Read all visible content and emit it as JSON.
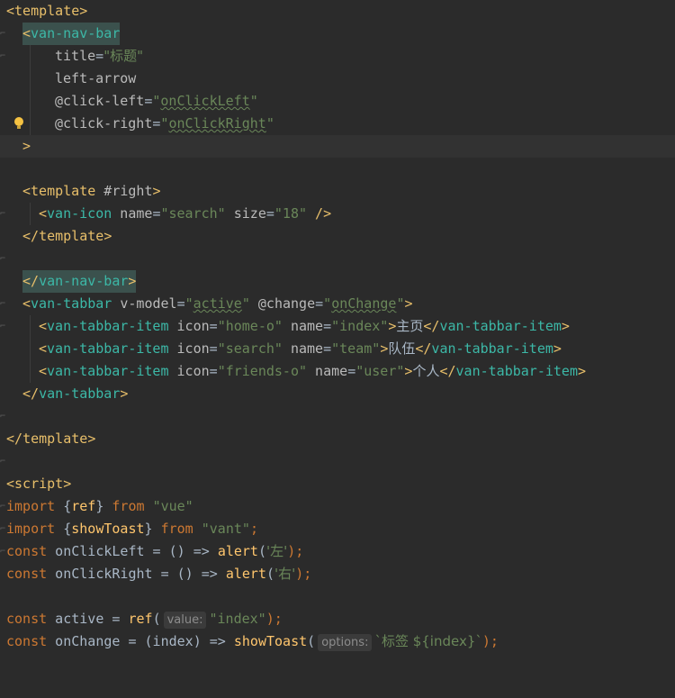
{
  "lines": {
    "l1": [
      "<",
      "template",
      ">"
    ],
    "l2": [
      "<",
      "van-nav-bar"
    ],
    "l3": [
      "title",
      "=",
      "\"标题\""
    ],
    "l4": [
      "left-arrow"
    ],
    "l5": [
      "@click-left",
      "=",
      "\"",
      "onClickLeft",
      "\""
    ],
    "l6": [
      "@click-right",
      "=",
      "\"",
      "onClickRight",
      "\""
    ],
    "l7": [
      ">"
    ],
    "l9": [
      "<",
      "template",
      " #right",
      ">"
    ],
    "l10": [
      "<",
      "van-icon",
      " name",
      "=",
      "\"search\"",
      " size",
      "=",
      "\"18\"",
      " />"
    ],
    "l11": [
      "</",
      "template",
      ">"
    ],
    "l13": [
      "</",
      "van-nav-bar",
      ">"
    ],
    "l14": [
      "<",
      "van-tabbar",
      " v-model",
      "=",
      "\"",
      "active",
      "\"",
      " @change",
      "=",
      "\"",
      "onChange",
      "\"",
      ">"
    ],
    "l15": [
      "<",
      "van-tabbar-item",
      " icon",
      "=",
      "\"home-o\"",
      " name",
      "=",
      "\"index\"",
      ">",
      "主页",
      "</",
      "van-tabbar-item",
      ">"
    ],
    "l16": [
      "<",
      "van-tabbar-item",
      " icon",
      "=",
      "\"search\"",
      " name",
      "=",
      "\"team\"",
      ">",
      "队伍",
      "</",
      "van-tabbar-item",
      ">"
    ],
    "l17": [
      "<",
      "van-tabbar-item",
      " icon",
      "=",
      "\"friends-o\"",
      " name",
      "=",
      "\"user\"",
      ">",
      "个人",
      "</",
      "van-tabbar-item",
      ">"
    ],
    "l18": [
      "</",
      "van-tabbar",
      ">"
    ],
    "l20": [
      "</",
      "template",
      ">"
    ],
    "l22": [
      "<",
      "script",
      ">"
    ],
    "l23": [
      "import",
      " {",
      "ref",
      "} ",
      "from",
      " ",
      "\"vue\""
    ],
    "l24": [
      "import",
      " {",
      "showToast",
      "} ",
      "from",
      " ",
      "\"vant\"",
      ";"
    ],
    "l25": [
      "const",
      " onClickLeft = () => ",
      "alert",
      "(",
      "'左'",
      ");"
    ],
    "l26": [
      "const",
      " onClickRight = () => ",
      "alert",
      "(",
      "'右'",
      ");"
    ],
    "l28": [
      "const",
      " active = ",
      "ref",
      "(",
      "value:",
      "\"index\"",
      ");"
    ],
    "l29": [
      "const",
      " onChange = (index) => ",
      "showToast",
      "(",
      "options:",
      "`标签 ${index}`",
      ");"
    ]
  }
}
